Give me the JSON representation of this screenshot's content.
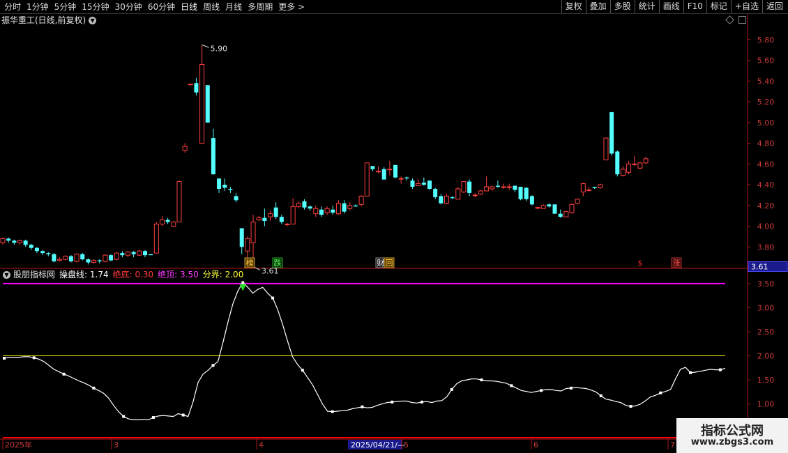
{
  "toolbar": {
    "period_tabs": [
      "分时",
      "1分钟",
      "5分钟",
      "15分钟",
      "30分钟",
      "60分钟",
      "日线",
      "周线",
      "月线",
      "多周期",
      "更多 >"
    ],
    "active_tab": "日线",
    "buttons": [
      "复权",
      "叠加",
      "多股",
      "统计",
      "画线",
      "F10",
      "标记",
      "+自选",
      "返回"
    ]
  },
  "main_title": "振华重工(日线,前复权)",
  "indicator": {
    "name": "股朋指标网",
    "items": [
      {
        "label": "操盘线: 1.74",
        "color": "#ffffff"
      },
      {
        "label": "绝底: 0.30",
        "color": "#ff3b3b"
      },
      {
        "label": "绝顶: 3.50",
        "color": "#ff3bff"
      },
      {
        "label": "分界: 2.00",
        "color": "#ffff3b"
      }
    ]
  },
  "colors": {
    "up": "#ff4040",
    "down": "#54ffff",
    "ceiling_line": "#ff00ff",
    "floor_line": "#ff0000",
    "divider_line": "#e6e600",
    "axis": "#b01818",
    "price_tag_bg": "#1a1a8c"
  },
  "price_axis": {
    "labels": [
      "5.80",
      "5.60",
      "5.40",
      "5.20",
      "5.00",
      "4.80",
      "4.60",
      "4.40",
      "4.20",
      "4.00",
      "3.80",
      "3.60"
    ],
    "current_price": "3.61"
  },
  "indicator_axis": {
    "labels": [
      "3.50",
      "3.00",
      "2.50",
      "2.00",
      "1.50",
      "1.00"
    ]
  },
  "date_axis": {
    "labels": [
      "2025年",
      "3",
      "4",
      "2025/04/21/—",
      "5",
      "6",
      "7"
    ]
  },
  "annotations": {
    "high": "5.90",
    "low": "3.61",
    "events": [
      "榜",
      "跌",
      "财",
      "回",
      "$",
      "涨"
    ]
  },
  "chart_data": {
    "type": "candlestick",
    "price_ylim": [
      3.6,
      5.94
    ],
    "candles": [
      [
        3.84,
        3.88,
        3.89,
        3.82
      ],
      [
        3.88,
        3.86,
        3.89,
        3.84
      ],
      [
        3.86,
        3.84,
        3.87,
        3.82
      ],
      [
        3.84,
        3.86,
        3.87,
        3.82
      ],
      [
        3.86,
        3.82,
        3.87,
        3.8
      ],
      [
        3.82,
        3.79,
        3.83,
        3.77
      ],
      [
        3.79,
        3.76,
        3.8,
        3.74
      ],
      [
        3.76,
        3.74,
        3.77,
        3.72
      ],
      [
        3.74,
        3.73,
        3.75,
        3.71
      ],
      [
        3.73,
        3.66,
        3.74,
        3.65
      ],
      [
        3.67,
        3.68,
        3.7,
        3.66
      ],
      [
        3.68,
        3.71,
        3.72,
        3.67
      ],
      [
        3.71,
        3.66,
        3.72,
        3.65
      ],
      [
        3.66,
        3.73,
        3.74,
        3.65
      ],
      [
        3.73,
        3.68,
        3.74,
        3.67
      ],
      [
        3.68,
        3.65,
        3.69,
        3.63
      ],
      [
        3.65,
        3.67,
        3.68,
        3.64
      ],
      [
        3.67,
        3.66,
        3.68,
        3.64
      ],
      [
        3.66,
        3.72,
        3.73,
        3.65
      ],
      [
        3.72,
        3.67,
        3.73,
        3.66
      ],
      [
        3.68,
        3.74,
        3.75,
        3.67
      ],
      [
        3.74,
        3.72,
        3.76,
        3.7
      ],
      [
        3.72,
        3.75,
        3.76,
        3.7
      ],
      [
        3.75,
        3.73,
        3.76,
        3.7
      ],
      [
        3.72,
        3.76,
        3.77,
        3.71
      ],
      [
        3.76,
        3.72,
        3.77,
        3.7
      ],
      [
        3.73,
        3.72,
        3.73,
        3.72
      ],
      [
        3.74,
        4.02,
        4.04,
        3.74
      ],
      [
        4.02,
        4.06,
        4.1,
        4.0
      ],
      [
        4.06,
        4.04,
        4.08,
        4.02
      ],
      [
        4.0,
        4.04,
        4.05,
        3.99
      ],
      [
        4.04,
        4.43,
        4.44,
        4.04
      ],
      [
        4.73,
        4.77,
        4.8,
        4.71
      ],
      [
        5.37,
        5.37,
        5.37,
        5.37
      ],
      [
        5.38,
        5.29,
        5.43,
        5.26
      ],
      [
        4.8,
        5.56,
        5.75,
        4.8
      ],
      [
        5.36,
        5.0,
        5.36,
        5.0
      ],
      [
        4.85,
        4.5,
        4.94,
        4.5
      ],
      [
        4.46,
        4.36,
        4.46,
        4.32
      ],
      [
        4.4,
        4.37,
        4.46,
        4.34
      ],
      [
        4.36,
        4.35,
        4.38,
        4.32
      ],
      [
        4.29,
        4.25,
        4.32,
        4.23
      ],
      [
        3.98,
        3.8,
        3.98,
        3.73
      ],
      [
        3.76,
        3.88,
        3.9,
        3.65
      ],
      [
        3.84,
        4.04,
        4.11,
        3.61
      ],
      [
        4.06,
        4.08,
        4.1,
        4.05
      ],
      [
        4.08,
        4.05,
        4.17,
        4.0
      ],
      [
        4.09,
        4.12,
        4.15,
        4.05
      ],
      [
        4.18,
        4.09,
        4.23,
        4.07
      ],
      [
        4.09,
        4.04,
        4.11,
        4.02
      ],
      [
        4.02,
        4.02,
        4.03,
        4.0
      ],
      [
        4.02,
        4.19,
        4.27,
        4.02
      ],
      [
        4.19,
        4.22,
        4.24,
        4.17
      ],
      [
        4.24,
        4.18,
        4.26,
        4.16
      ],
      [
        4.19,
        4.17,
        4.2,
        4.15
      ],
      [
        4.12,
        4.17,
        4.2,
        4.09
      ],
      [
        4.16,
        4.11,
        4.19,
        4.09
      ],
      [
        4.13,
        4.17,
        4.19,
        4.11
      ],
      [
        4.16,
        4.13,
        4.2,
        4.11
      ],
      [
        4.12,
        4.22,
        4.25,
        4.11
      ],
      [
        4.22,
        4.14,
        4.25,
        4.12
      ],
      [
        4.17,
        4.2,
        4.23,
        4.15
      ],
      [
        4.2,
        4.19,
        4.21,
        4.19
      ],
      [
        4.21,
        4.29,
        4.3,
        4.19
      ],
      [
        4.29,
        4.61,
        4.61,
        4.29
      ],
      [
        4.58,
        4.55,
        4.58,
        4.53
      ],
      [
        4.53,
        4.53,
        4.58,
        4.51
      ],
      [
        4.55,
        4.45,
        4.57,
        4.45
      ],
      [
        4.55,
        4.55,
        4.63,
        4.49
      ],
      [
        4.59,
        4.47,
        4.59,
        4.46
      ],
      [
        4.46,
        4.46,
        4.48,
        4.41
      ],
      [
        4.47,
        4.46,
        4.48,
        4.44
      ],
      [
        4.44,
        4.38,
        4.46,
        4.36
      ],
      [
        4.39,
        4.41,
        4.45,
        4.39
      ],
      [
        4.42,
        4.4,
        4.47,
        4.39
      ],
      [
        4.44,
        4.36,
        4.44,
        4.35
      ],
      [
        4.36,
        4.28,
        4.37,
        4.26
      ],
      [
        4.29,
        4.22,
        4.31,
        4.21
      ],
      [
        4.22,
        4.29,
        4.31,
        4.21
      ],
      [
        4.28,
        4.27,
        4.29,
        4.26
      ],
      [
        4.26,
        4.36,
        4.38,
        4.26
      ],
      [
        4.33,
        4.43,
        4.43,
        4.32
      ],
      [
        4.43,
        4.32,
        4.45,
        4.29
      ],
      [
        4.3,
        4.3,
        4.32,
        4.28
      ],
      [
        4.31,
        4.34,
        4.35,
        4.3
      ],
      [
        4.34,
        4.38,
        4.48,
        4.34
      ],
      [
        4.36,
        4.38,
        4.39,
        4.34
      ],
      [
        4.39,
        4.38,
        4.44,
        4.37
      ],
      [
        4.38,
        4.38,
        4.41,
        4.36
      ],
      [
        4.38,
        4.38,
        4.41,
        4.35
      ],
      [
        4.39,
        4.35,
        4.39,
        4.33
      ],
      [
        4.38,
        4.26,
        4.38,
        4.25
      ],
      [
        4.37,
        4.26,
        4.38,
        4.24
      ],
      [
        4.29,
        4.21,
        4.3,
        4.2
      ],
      [
        4.18,
        4.18,
        4.19,
        4.16
      ],
      [
        4.17,
        4.2,
        4.21,
        4.17
      ],
      [
        4.21,
        4.19,
        4.22,
        4.18
      ],
      [
        4.21,
        4.12,
        4.21,
        4.12
      ],
      [
        4.12,
        4.09,
        4.16,
        4.08
      ],
      [
        4.09,
        4.14,
        4.15,
        4.09
      ],
      [
        4.13,
        4.21,
        4.22,
        4.12
      ],
      [
        4.22,
        4.26,
        4.27,
        4.21
      ],
      [
        4.33,
        4.41,
        4.42,
        4.29
      ],
      [
        4.35,
        4.35,
        4.38,
        4.33
      ],
      [
        4.38,
        4.37,
        4.38,
        4.36
      ],
      [
        4.37,
        4.4,
        4.41,
        4.36
      ],
      [
        4.64,
        4.85,
        4.85,
        4.64
      ],
      [
        5.1,
        4.7,
        5.1,
        4.68
      ],
      [
        4.72,
        4.5,
        4.73,
        4.48
      ],
      [
        4.49,
        4.55,
        4.58,
        4.48
      ],
      [
        4.52,
        4.6,
        4.63,
        4.5
      ],
      [
        4.6,
        4.6,
        4.68,
        4.58
      ],
      [
        4.56,
        4.61,
        4.62,
        4.55
      ],
      [
        4.61,
        4.65,
        4.67,
        4.6
      ]
    ],
    "indicator": {
      "name": "操盘线",
      "ylim": [
        0.3,
        3.6
      ],
      "ceiling": 3.5,
      "divider": 2.0,
      "floor": 0.3,
      "values": [
        1.95,
        1.97,
        1.97,
        1.97,
        1.98,
        1.98,
        1.96,
        1.93,
        1.88,
        1.8,
        1.72,
        1.67,
        1.62,
        1.58,
        1.53,
        1.48,
        1.44,
        1.39,
        1.33,
        1.28,
        1.22,
        1.12,
        0.97,
        0.84,
        0.74,
        0.69,
        0.67,
        0.67,
        0.68,
        0.67,
        0.72,
        0.75,
        0.76,
        0.75,
        0.74,
        0.8,
        0.77,
        0.74,
        1.05,
        1.45,
        1.62,
        1.7,
        1.8,
        1.88,
        2.28,
        2.7,
        3.08,
        3.35,
        3.52,
        3.42,
        3.3,
        3.38,
        3.42,
        3.3,
        3.2,
        2.96,
        2.65,
        2.3,
        1.98,
        1.82,
        1.7,
        1.55,
        1.4,
        1.2,
        1.0,
        0.85,
        0.84,
        0.85,
        0.86,
        0.87,
        0.9,
        0.92,
        0.94,
        0.92,
        0.93,
        0.97,
        1.0,
        1.03,
        1.04,
        1.05,
        1.06,
        1.06,
        1.03,
        1.02,
        1.04,
        1.05,
        1.03,
        1.06,
        1.07,
        1.15,
        1.3,
        1.42,
        1.48,
        1.5,
        1.52,
        1.52,
        1.5,
        1.48,
        1.48,
        1.47,
        1.45,
        1.43,
        1.38,
        1.33,
        1.28,
        1.26,
        1.24,
        1.26,
        1.28,
        1.3,
        1.3,
        1.28,
        1.27,
        1.32,
        1.33,
        1.34,
        1.33,
        1.32,
        1.29,
        1.25,
        1.17,
        1.1,
        1.08,
        1.05,
        1.03,
        0.97,
        0.95,
        0.96,
        1.0,
        1.07,
        1.15,
        1.18,
        1.23,
        1.26,
        1.3,
        1.52,
        1.72,
        1.76,
        1.65,
        1.66,
        1.68,
        1.7,
        1.72,
        1.71,
        1.71,
        1.74
      ]
    }
  }
}
